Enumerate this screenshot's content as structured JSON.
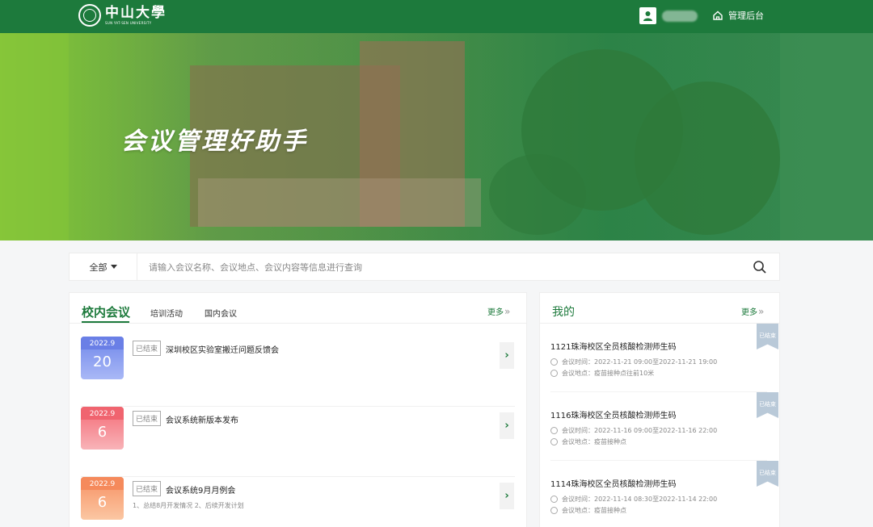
{
  "header": {
    "logo_cn": "中山大學",
    "logo_en": "SUN YAT-SEN UNIVERSITY",
    "admin_label": "管理后台"
  },
  "banner": {
    "title": "会议管理好助手"
  },
  "search": {
    "filter_label": "全部",
    "placeholder": "请输入会议名称、会议地点、会议内容等信息进行查询"
  },
  "left_panel": {
    "tabs": [
      "校内会议",
      "培训活动",
      "国内会议"
    ],
    "more_label": "更多",
    "meetings": [
      {
        "month": "2022.9",
        "day": "20",
        "status": "已结束",
        "title": "深圳校区实验室搬迁问题反馈会",
        "desc": "",
        "color": "#8fa3f0"
      },
      {
        "month": "2022.9",
        "day": "6",
        "status": "已结束",
        "title": "会议系统新版本发布",
        "desc": "",
        "color": "#f59aa0"
      },
      {
        "month": "2022.9",
        "day": "6",
        "status": "已结束",
        "title": "会议系统9月月例会",
        "desc": "1、总结8月开发情况 2、后续开发计划",
        "color": "#f8b48a"
      }
    ]
  },
  "right_panel": {
    "title": "我的",
    "more_label": "更多",
    "items": [
      {
        "title": "1121珠海校区全员核酸检测师生码",
        "time_label": "会议时间：",
        "time": "2022-11-21 09:00至2022-11-21 19:00",
        "place_label": "会议地点：",
        "place": "疫苗接种点往前10米",
        "status": "已结束"
      },
      {
        "title": "1116珠海校区全员核酸检测师生码",
        "time_label": "会议时间：",
        "time": "2022-11-16 09:00至2022-11-16 22:00",
        "place_label": "会议地点：",
        "place": "疫苗接种点",
        "status": "已结束"
      },
      {
        "title": "1114珠海校区全员核酸检测师生码",
        "time_label": "会议时间：",
        "time": "2022-11-14 08:30至2022-11-14 22:00",
        "place_label": "会议地点：",
        "place": "疫苗接种点",
        "status": "已结束"
      }
    ]
  }
}
